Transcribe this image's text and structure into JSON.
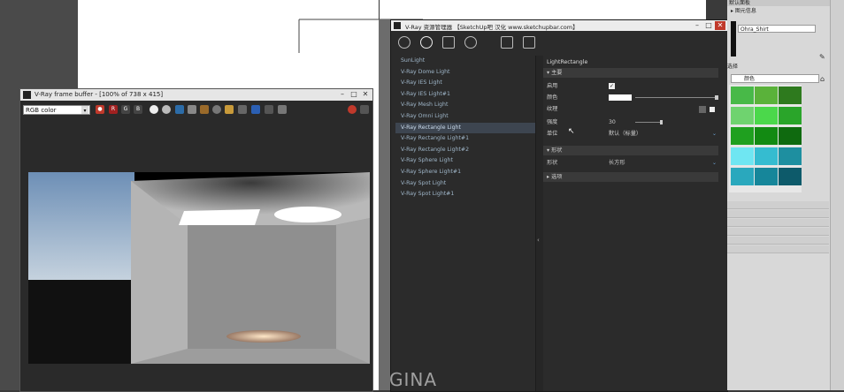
{
  "frame_buffer": {
    "title": "V-Ray frame buffer - [100% of 738 x 415]",
    "channel_select": "RGB color",
    "toolbar_letters": [
      "R",
      "G",
      "B"
    ]
  },
  "asset_editor": {
    "title": "V-Ray 资源管理器 【SketchUp吧 汉化 www.sketchupbar.com】",
    "lights": [
      "SunLight",
      "V-Ray Dome Light",
      "V-Ray IES Light",
      "V-Ray IES Light#1",
      "V-Ray Mesh Light",
      "V-Ray Omni Light",
      "V-Ray Rectangle Light",
      "V-Ray Rectangle Light#1",
      "V-Ray Rectangle Light#2",
      "V-Ray Sphere Light",
      "V-Ray Sphere Light#1",
      "V-Ray Spot Light",
      "V-Ray Spot Light#1"
    ],
    "selected_index": 6,
    "props": {
      "heading": "LightRectangle",
      "sec_main": "主要",
      "enabled_label": "启用",
      "color_label": "颜色",
      "texture_label": "纹理",
      "intensity_label": "强度",
      "intensity_value": "30",
      "units_label": "单位",
      "units_value": "默认（标量）",
      "sec_shape": "形状",
      "shape_label": "形状",
      "shape_value": "长方形",
      "sec_options": "选项"
    }
  },
  "right_panel": {
    "header": "默认面板",
    "tray_item": "图元信息",
    "material_name": "Ohra_Shirt",
    "category_label": "颜色",
    "tab_label": "选择"
  },
  "watermark": "GINA",
  "colors": {
    "swatches": [
      "#48b948",
      "#5ab23a",
      "#2e7a1e",
      "#6fd36f",
      "#4bd84b",
      "#2aa52a",
      "#1fa01f",
      "#128a12",
      "#0f6a0f",
      "#6fe6f2",
      "#35bcd0",
      "#1e8fa0",
      "#2aa8bd",
      "#16869a",
      "#0d5a6a"
    ]
  }
}
